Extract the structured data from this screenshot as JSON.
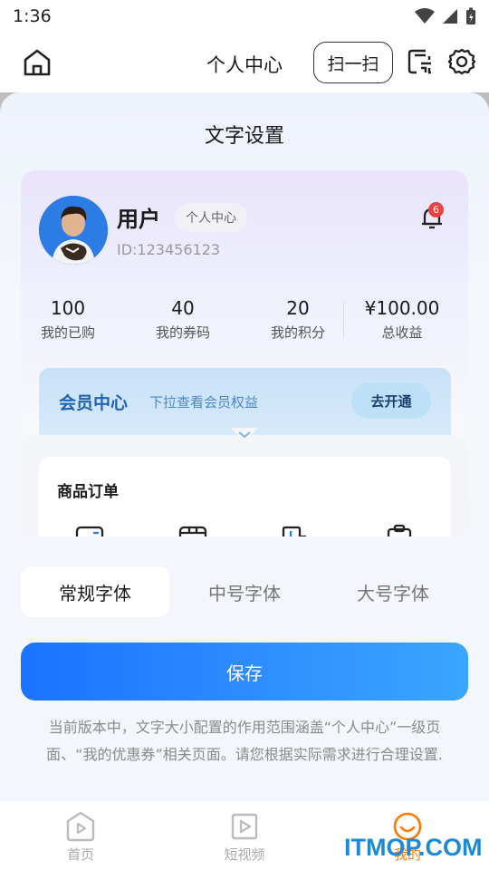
{
  "status": {
    "time": "1:36"
  },
  "header": {
    "title": "个人中心",
    "scan_label": "扫一扫"
  },
  "sheet": {
    "title": "文字设置"
  },
  "preview": {
    "username": "用户",
    "badge": "个人中心",
    "user_id": "ID:123456123",
    "notification_count": "6",
    "stats": [
      {
        "value": "100",
        "label": "我的已购"
      },
      {
        "value": "40",
        "label": "我的券码"
      },
      {
        "value": "20",
        "label": "我的积分"
      },
      {
        "value": "¥100.00",
        "label": "总收益"
      }
    ],
    "member": {
      "title": "会员中心",
      "subtitle": "下拉查看会员权益",
      "button": "去开通"
    },
    "orders": {
      "title": "商品订单"
    }
  },
  "font_options": [
    {
      "label": "常规字体",
      "selected": true
    },
    {
      "label": "中号字体",
      "selected": false
    },
    {
      "label": "大号字体",
      "selected": false
    }
  ],
  "save_label": "保存",
  "note": "当前版本中，文字大小配置的作用范围涵盖“个人中心”一级页面、“我的优惠券”相关页面。请您根据实际需求进行合理设置.",
  "nav": [
    {
      "label": "首页",
      "icon": "home-play-icon"
    },
    {
      "label": "短视频",
      "icon": "video-icon"
    },
    {
      "label": "我的",
      "icon": "smile-icon"
    }
  ],
  "watermark": "ITMOP.COM",
  "colors": {
    "accent": "#1b73ff",
    "member_text": "#1e63b6",
    "badge_red": "#f04141",
    "active_nav": "#ff7a00"
  }
}
